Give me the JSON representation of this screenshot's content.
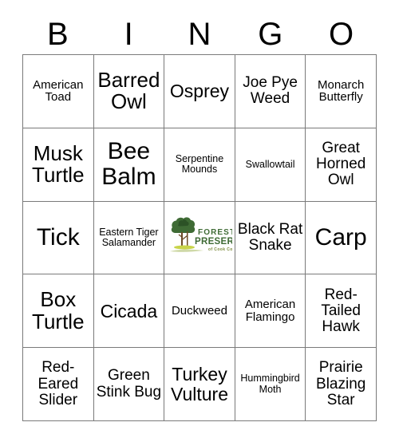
{
  "header": {
    "letters": [
      "B",
      "I",
      "N",
      "G",
      "O"
    ]
  },
  "grid": {
    "rows": [
      [
        {
          "label": "American Toad",
          "size": "t-sm"
        },
        {
          "label": "Barred Owl",
          "size": "t-xl"
        },
        {
          "label": "Osprey",
          "size": "t-lg"
        },
        {
          "label": "Joe Pye Weed",
          "size": "t-md"
        },
        {
          "label": "Monarch Butterfly",
          "size": "t-sm"
        }
      ],
      [
        {
          "label": "Musk Turtle",
          "size": "t-xl"
        },
        {
          "label": "Bee Balm",
          "size": "t-xxl"
        },
        {
          "label": "Serpentine Mounds",
          "size": "t-xs"
        },
        {
          "label": "Swallowtail",
          "size": "t-xs"
        },
        {
          "label": "Great Horned Owl",
          "size": "t-md"
        }
      ],
      [
        {
          "label": "Tick",
          "size": "t-xxl"
        },
        {
          "label": "Eastern Tiger Salamander",
          "size": "t-xs"
        },
        {
          "label": "",
          "size": "logo",
          "logo": {
            "line1": "FOREST",
            "line2": "PRESERVES",
            "line3": "of Cook County",
            "tree_color": "#3f6b35",
            "text_color": "#3f6b35",
            "ground_color": "#c8d44a"
          }
        },
        {
          "label": "Black Rat Snake",
          "size": "t-md"
        },
        {
          "label": "Carp",
          "size": "t-xxl"
        }
      ],
      [
        {
          "label": "Box Turtle",
          "size": "t-xl"
        },
        {
          "label": "Cicada",
          "size": "t-lg"
        },
        {
          "label": "Duckweed",
          "size": "t-sm"
        },
        {
          "label": "American Flamingo",
          "size": "t-sm"
        },
        {
          "label": "Red-Tailed Hawk",
          "size": "t-md"
        }
      ],
      [
        {
          "label": "Red-Eared Slider",
          "size": "t-md"
        },
        {
          "label": "Green Stink Bug",
          "size": "t-md"
        },
        {
          "label": "Turkey Vulture",
          "size": "t-lg"
        },
        {
          "label": "Hummingbird Moth",
          "size": "t-xs"
        },
        {
          "label": "Prairie Blazing Star",
          "size": "t-md"
        }
      ]
    ]
  }
}
